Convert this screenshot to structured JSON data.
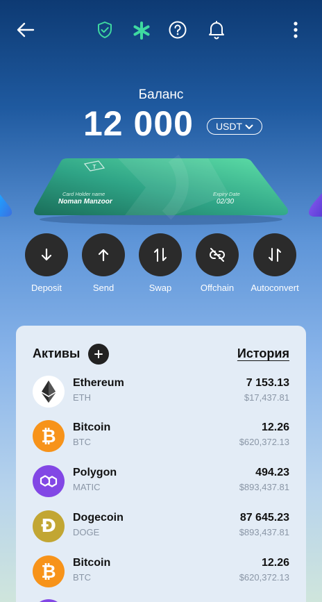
{
  "topbar": {
    "icons": [
      "back-arrow-icon",
      "shield-check-icon",
      "asterisk-icon",
      "help-icon",
      "bell-icon",
      "more-vertical-icon"
    ]
  },
  "balance": {
    "label": "Баланс",
    "amount": "12 000",
    "currency": "USDT"
  },
  "card": {
    "holder_label": "Card Holder name",
    "holder_name": "Noman Manzoor",
    "expiry_label": "Expiry Date",
    "expiry": "02/30"
  },
  "actions": [
    {
      "label": "Deposit",
      "icon": "arrow-down-icon"
    },
    {
      "label": "Send",
      "icon": "arrow-up-icon"
    },
    {
      "label": "Swap",
      "icon": "swap-icon"
    },
    {
      "label": "Offchain",
      "icon": "link-off-icon"
    },
    {
      "label": "Autoconvert",
      "icon": "autoconvert-icon"
    }
  ],
  "assets_panel": {
    "title": "Активы",
    "history": "История",
    "items": [
      {
        "name": "Ethereum",
        "symbol": "ETH",
        "amount": "7 153.13",
        "fiat": "$17,437.81",
        "icon": "ethereum-icon",
        "color": "#ffffff"
      },
      {
        "name": "Bitcoin",
        "symbol": "BTC",
        "amount": "12.26",
        "fiat": "$620,372.13",
        "icon": "bitcoin-icon",
        "color": "#f7931a"
      },
      {
        "name": "Polygon",
        "symbol": "MATIC",
        "amount": "494.23",
        "fiat": "$893,437.81",
        "icon": "polygon-icon",
        "color": "#8247e5"
      },
      {
        "name": "Dogecoin",
        "symbol": "DOGE",
        "amount": "87 645.23",
        "fiat": "$893,437.81",
        "icon": "dogecoin-icon",
        "color": "#c2a633"
      },
      {
        "name": "Bitcoin",
        "symbol": "BTC",
        "amount": "12.26",
        "fiat": "$620,372.13",
        "icon": "bitcoin-icon",
        "color": "#f7931a"
      }
    ]
  },
  "colors": {
    "accent_green": "#3fd9a0",
    "action_bg": "#2b2b2b",
    "panel_bg": "#e3ecf6"
  }
}
